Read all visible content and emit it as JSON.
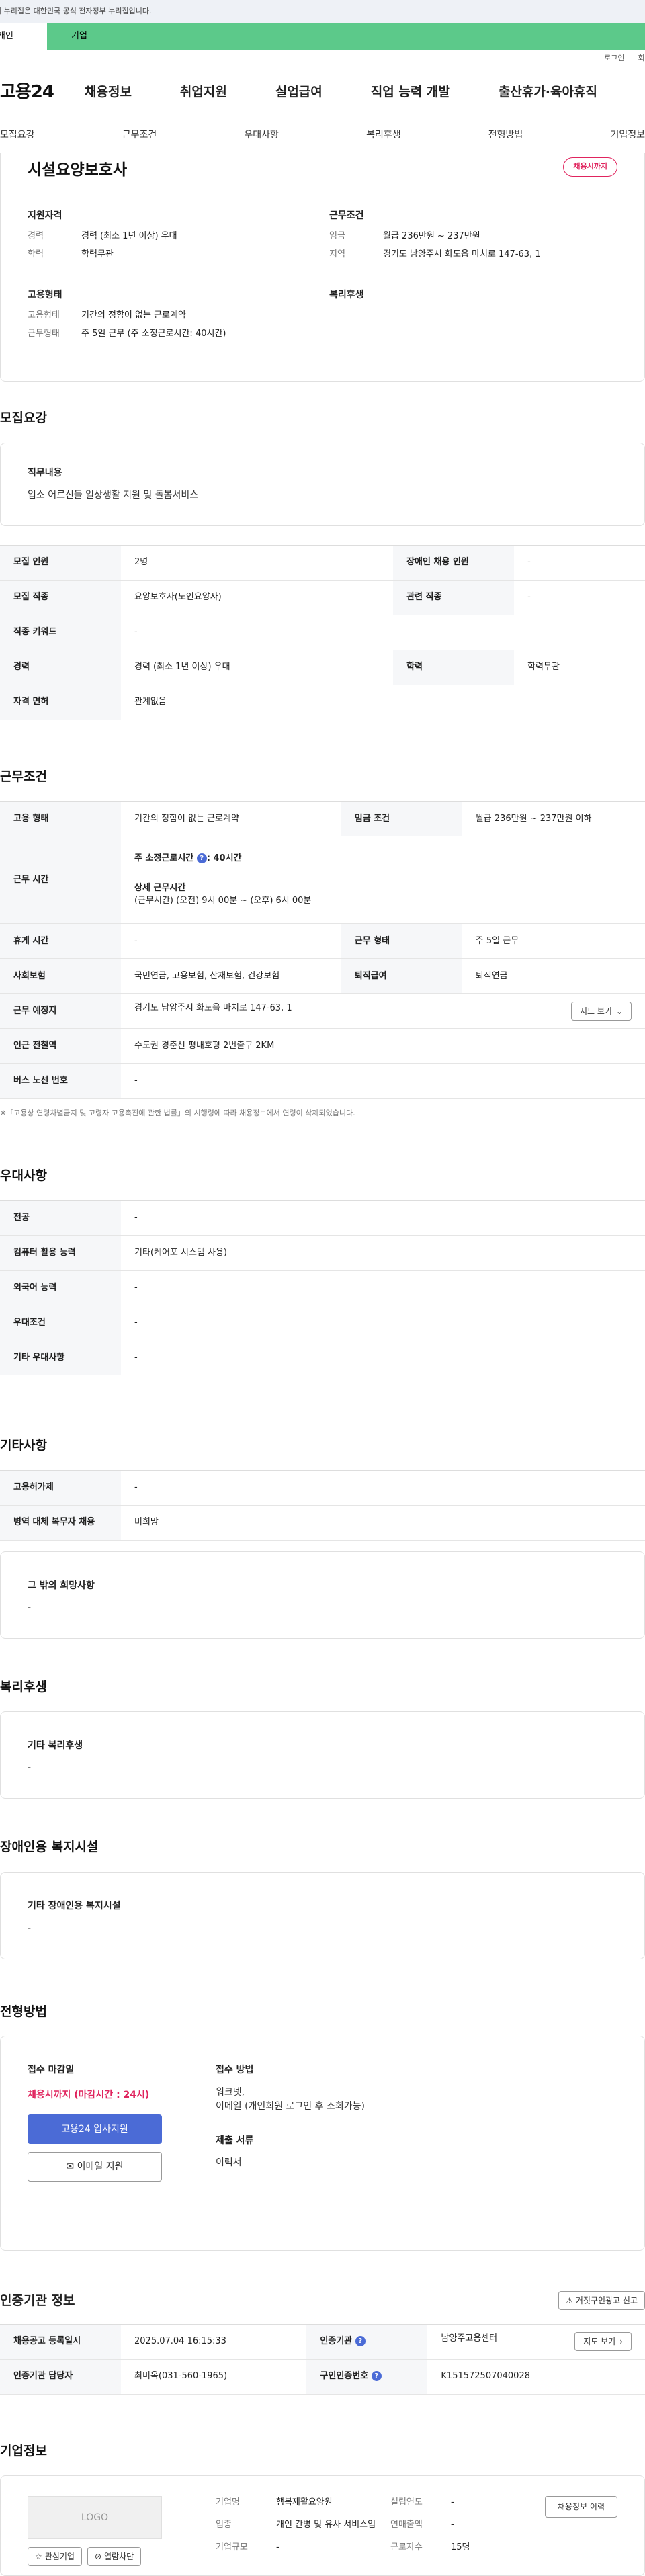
{
  "gov_notice": "이 누리집은 대한민국 공식 전자정부 누리집입니다.",
  "gov_tabs": [
    "개인",
    "기업"
  ],
  "top_links": [
    "로그인",
    "회원가입"
  ],
  "logo": "고용24",
  "gnb": [
    "채용정보",
    "취업지원",
    "실업급여",
    "직업 능력 개발",
    "출산휴가·육아휴직"
  ],
  "subnav": [
    "모집요강",
    "근무조건",
    "우대사항",
    "복리후생",
    "전형방법",
    "기업정보"
  ],
  "top": {
    "company": "시설요양보호사",
    "badge": "채용시까지",
    "qual_head": "지원자격",
    "qual": [
      [
        "경력",
        "경력 (최소 1년 이상) 우대"
      ],
      [
        "학력",
        "학력무관"
      ]
    ],
    "work_head": "근무조건",
    "work": [
      [
        "임금",
        "월급 236만원 ~ 237만원"
      ],
      [
        "지역",
        "경기도 남양주시 화도읍 마치로 147-63, 1"
      ]
    ],
    "emp_head": "고용형태",
    "emp": [
      [
        "고용형태",
        "기간의 정함이 없는 근로계약"
      ],
      [
        "근무형태",
        "주 5일 근무 (주 소정근로시간: 40시간)"
      ]
    ],
    "welfare_head": "복리후생"
  },
  "recruit": {
    "title": "모집요강",
    "duty_head": "직무내용",
    "duty": "입소 어르신들 일상생활 지원 및 돌봄서비스",
    "rows": [
      [
        "모집 인원",
        "2명",
        "장애인 채용 인원",
        "-"
      ],
      [
        "모집 직종",
        "요양보호사(노인요양사)",
        "관련 직종",
        "-"
      ],
      [
        "직종 키워드",
        "-"
      ],
      [
        "경력",
        "경력 (최소 1년 이상) 우대",
        "학력",
        "학력무관"
      ],
      [
        "자격 면허",
        "관계없음"
      ]
    ]
  },
  "condition": {
    "title": "근무조건",
    "emp_label": "고용 형태",
    "emp_value": "기간의 정함이 없는 근로계약",
    "wage_label": "임금 조건",
    "wage_value": "월급 236만원 ~ 237만원 이하",
    "hours_label": "근무 시간",
    "hours_main": "주 소정근로시간",
    "hours_main_value": ": 40시간",
    "hours_detail_head": "상세 근무시간",
    "hours_detail": "(근무시간) (오전) 9시 00분 ~ (오후) 6시 00분",
    "break_label": "휴게 시간",
    "break_value": "-",
    "form_label": "근무 형태",
    "form_value": "주 5일 근무",
    "insurance_label": "사회보험",
    "insurance_value": "국민연금, 고용보험, 산재보험, 건강보험",
    "retire_label": "퇴직급여",
    "retire_value": "퇴직연금",
    "place_label": "근무 예정지",
    "place_value": "경기도 남양주시 화도읍 마치로 147-63, 1",
    "map_btn": "지도 보기",
    "station_label": "인근 전철역",
    "station_value": "수도권 경춘선 평내호평 2번출구 2KM",
    "bus_label": "버스 노선 번호",
    "bus_value": "-",
    "note": "※「고용상 연령차별금지 및 고령자 고용촉진에 관한 법률」의 시행령에 따라 채용정보에서 연령이 삭제되었습니다."
  },
  "prefer": {
    "title": "우대사항",
    "rows": [
      [
        "전공",
        "-"
      ],
      [
        "컴퓨터 활용 능력",
        "기타(케어포 시스템 사용)"
      ],
      [
        "외국어 능력",
        "-"
      ],
      [
        "우대조건",
        "-"
      ],
      [
        "기타 우대사항",
        "-"
      ]
    ]
  },
  "etc": {
    "title": "기타사항",
    "rows": [
      [
        "고용허가제",
        "-"
      ],
      [
        "병역 대체 복무자 채용",
        "비희망"
      ]
    ],
    "box_head": "그 밖의 희망사항",
    "box_value": "-"
  },
  "welfare": {
    "title": "복리후생",
    "box_head": "기타 복리후생",
    "box_value": "-"
  },
  "disabled": {
    "title": "장애인용 복지시설",
    "box_head": "기타 장애인용 복지시설",
    "box_value": "-"
  },
  "selection": {
    "title": "전형방법",
    "deadline_head": "접수 마감일",
    "deadline": "채용시까지 (마감시간 : 24시)",
    "apply_btn": "고용24 입사지원",
    "email_btn": "이메일 지원",
    "method_head": "접수 방법",
    "method_1": "워크넷,",
    "method_2": "이메일 (개인회원 로그인 후 조회가능)",
    "docs_head": "제출 서류",
    "docs": "이력서"
  },
  "agency": {
    "title": "인증기관 정보",
    "report_btn": "거짓구인광고 신고",
    "reg_label": "채용공고 등록일시",
    "reg_value": "2025.07.04 16:15:33",
    "org_label": "인증기관",
    "org_value": "남양주고용센터",
    "map_btn": "지도 보기",
    "mgr_label": "인증기관 담당자",
    "mgr_value": "최미옥(031-560-1965)",
    "no_label": "구인인증번호",
    "no_value": "K151572507040028"
  },
  "company": {
    "title": "기업정보",
    "logo": "LOGO",
    "fav_btn": "관심기업",
    "block_btn": "열람차단",
    "name_label": "기업명",
    "name_value": "행복재활요양원",
    "ind_label": "업종",
    "ind_value": "개인 간병 및 유사 서비스업",
    "size_label": "기업규모",
    "size_value": "-",
    "year_label": "설립연도",
    "year_value": "-",
    "sales_label": "연매출액",
    "sales_value": "-",
    "staff_label": "근로자수",
    "staff_value": "15명",
    "history_btn": "채용정보 이력"
  }
}
